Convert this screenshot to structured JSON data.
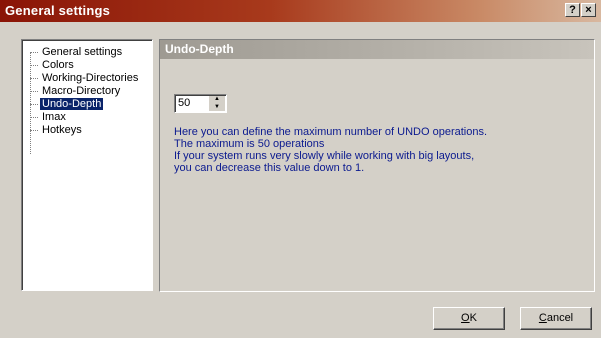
{
  "window": {
    "title": "General settings",
    "help_label": "?",
    "close_label": "×"
  },
  "tree": {
    "items": [
      {
        "label": "General settings"
      },
      {
        "label": "Colors"
      },
      {
        "label": "Working-Directories"
      },
      {
        "label": "Macro-Directory"
      },
      {
        "label": "Undo-Depth",
        "selected": true
      },
      {
        "label": "Imax"
      },
      {
        "label": "Hotkeys"
      }
    ]
  },
  "panel": {
    "header": "Undo-Depth",
    "spin_value": "50",
    "description": [
      "Here you can define the maximum number of UNDO operations.",
      "The maximum is 50 operations",
      "If your system runs very slowly while working with big layouts,",
      "you can decrease this value down to 1."
    ]
  },
  "buttons": {
    "ok_mnemonic": "O",
    "ok_rest": "K",
    "cancel_mnemonic": "C",
    "cancel_rest": "ancel"
  }
}
